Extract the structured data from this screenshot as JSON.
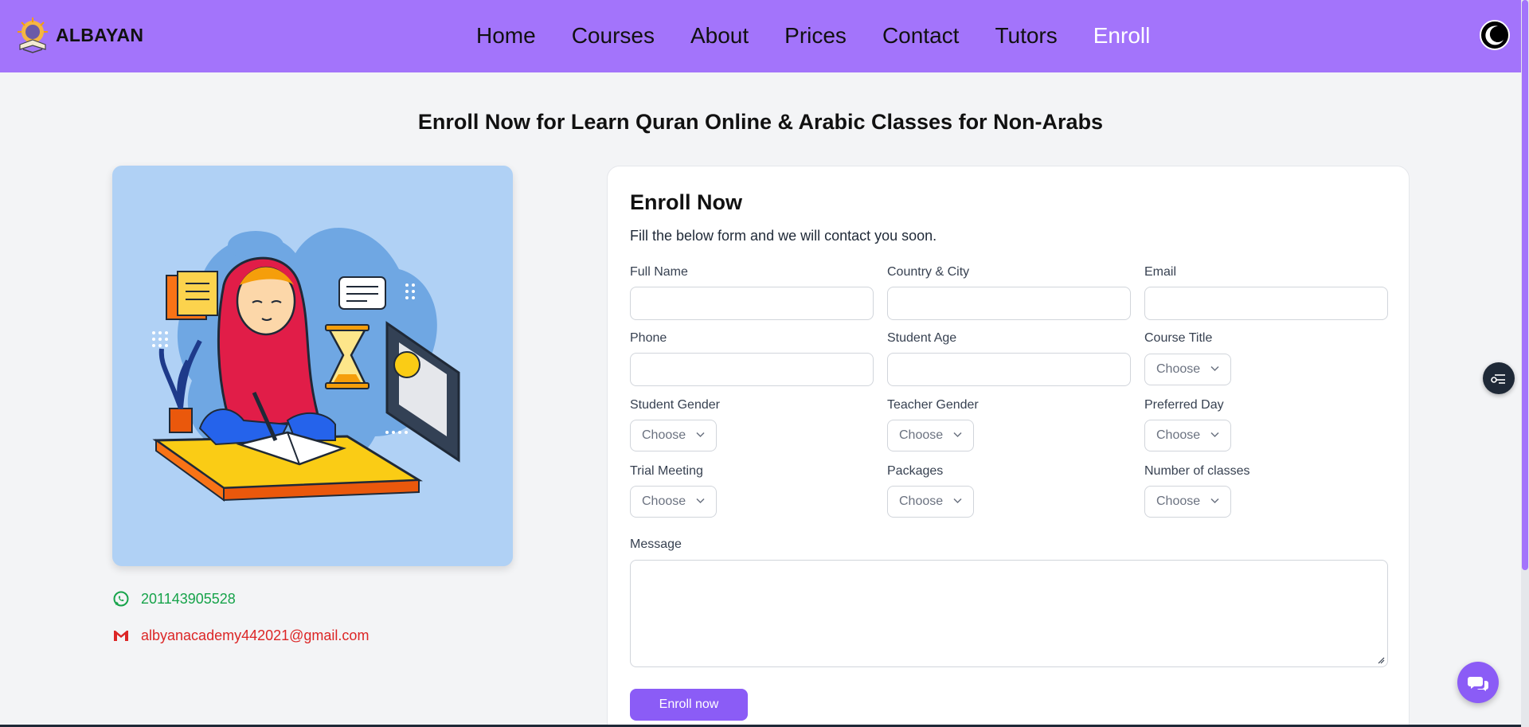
{
  "header": {
    "brand": "ALBAYAN",
    "nav": [
      {
        "label": "Home"
      },
      {
        "label": "Courses"
      },
      {
        "label": "About"
      },
      {
        "label": "Prices"
      },
      {
        "label": "Contact"
      },
      {
        "label": "Tutors"
      },
      {
        "label": "Enroll"
      }
    ]
  },
  "page": {
    "title": "Enroll Now for Learn Quran Online & Arabic Classes for Non-Arabs"
  },
  "contact": {
    "phone": "201143905528",
    "email": "albyanacademy442021@gmail.com"
  },
  "form": {
    "title": "Enroll Now",
    "subtitle": "Fill the below form and we will contact you soon.",
    "labels": {
      "full_name": "Full Name",
      "country_city": "Country & City",
      "email": "Email",
      "phone": "Phone",
      "student_age": "Student Age",
      "course_title": "Course Title",
      "student_gender": "Student Gender",
      "teacher_gender": "Teacher Gender",
      "preferred_day": "Preferred Day",
      "trial_meeting": "Trial Meeting",
      "packages": "Packages",
      "number_of_classes": "Number of classes",
      "message": "Message"
    },
    "select_placeholder": "Choose",
    "submit_label": "Enroll now"
  },
  "colors": {
    "header_bg": "#a374fb",
    "accent": "#8b5cf6",
    "whatsapp": "#16a34a",
    "email": "#dc2626"
  }
}
